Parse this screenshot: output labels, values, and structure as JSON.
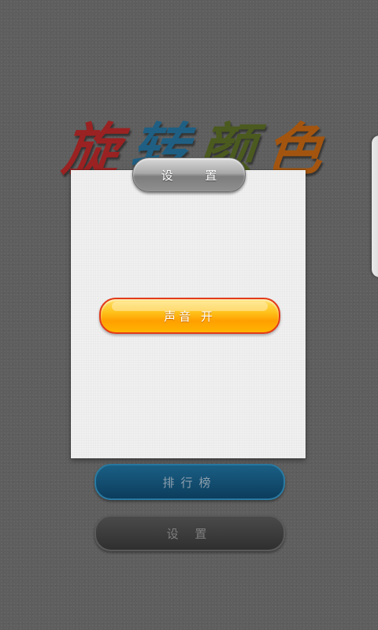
{
  "title": {
    "chars": [
      {
        "text": "旋",
        "color": "#9a2222"
      },
      {
        "text": "转",
        "color": "#1f5f83"
      },
      {
        "text": "颜",
        "color": "#4b5a1e"
      },
      {
        "text": "色",
        "color": "#a3550f"
      }
    ]
  },
  "dialog": {
    "tab_label": "设 置",
    "sound_button_label": "声音 开"
  },
  "background_menu": {
    "rank_label": "排行榜",
    "settings_label": "设 置"
  },
  "colors": {
    "background": "#5e5e5e",
    "panel": "#f0f0f0",
    "sound_button": "#ffb400",
    "sound_button_border": "#e23a1a",
    "rank_button": "#0c3d5c"
  }
}
